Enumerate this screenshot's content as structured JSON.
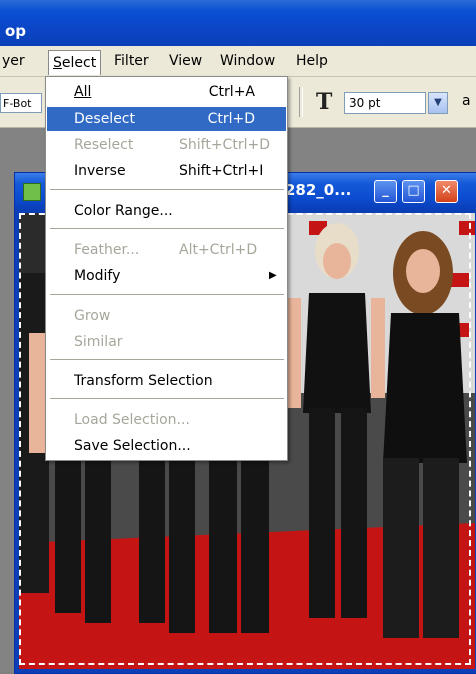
{
  "app": {
    "title": "op"
  },
  "menubar": {
    "items": [
      {
        "label": "yer",
        "accel": ""
      },
      {
        "label": "Select",
        "accel": "S",
        "active": true
      },
      {
        "label": "Filter",
        "accel": "t"
      },
      {
        "label": "View",
        "accel": "V"
      },
      {
        "label": "Window",
        "accel": "W"
      },
      {
        "label": "Help",
        "accel": "H"
      }
    ]
  },
  "options": {
    "style_field": "F-Bot",
    "font_size": "30 pt",
    "trailing": "a"
  },
  "document": {
    "title": "282_0..."
  },
  "select_menu": {
    "items": [
      {
        "label": "All",
        "shortcut": "Ctrl+A",
        "state": "normal"
      },
      {
        "label": "Deselect",
        "shortcut": "Ctrl+D",
        "state": "highlighted"
      },
      {
        "label": "Reselect",
        "shortcut": "Shift+Ctrl+D",
        "state": "disabled"
      },
      {
        "label": "Inverse",
        "shortcut": "Shift+Ctrl+I",
        "state": "normal"
      },
      {
        "label": "Color Range...",
        "shortcut": "",
        "state": "normal"
      },
      {
        "label": "Feather...",
        "shortcut": "Alt+Ctrl+D",
        "state": "disabled"
      },
      {
        "label": "Modify",
        "shortcut": "",
        "state": "normal",
        "submenu": true
      },
      {
        "label": "Grow",
        "shortcut": "",
        "state": "disabled"
      },
      {
        "label": "Similar",
        "shortcut": "",
        "state": "disabled"
      },
      {
        "label": "Transform Selection",
        "shortcut": "",
        "state": "normal"
      },
      {
        "label": "Load Selection...",
        "shortcut": "",
        "state": "disabled"
      },
      {
        "label": "Save Selection...",
        "shortcut": "",
        "state": "normal"
      }
    ]
  },
  "colors": {
    "highlight": "#316ac5",
    "menu_bg": "#ece9d8",
    "title_blue": "#0a4fd3",
    "disabled_text": "#a7a69b",
    "carpet_red": "#c41414"
  }
}
